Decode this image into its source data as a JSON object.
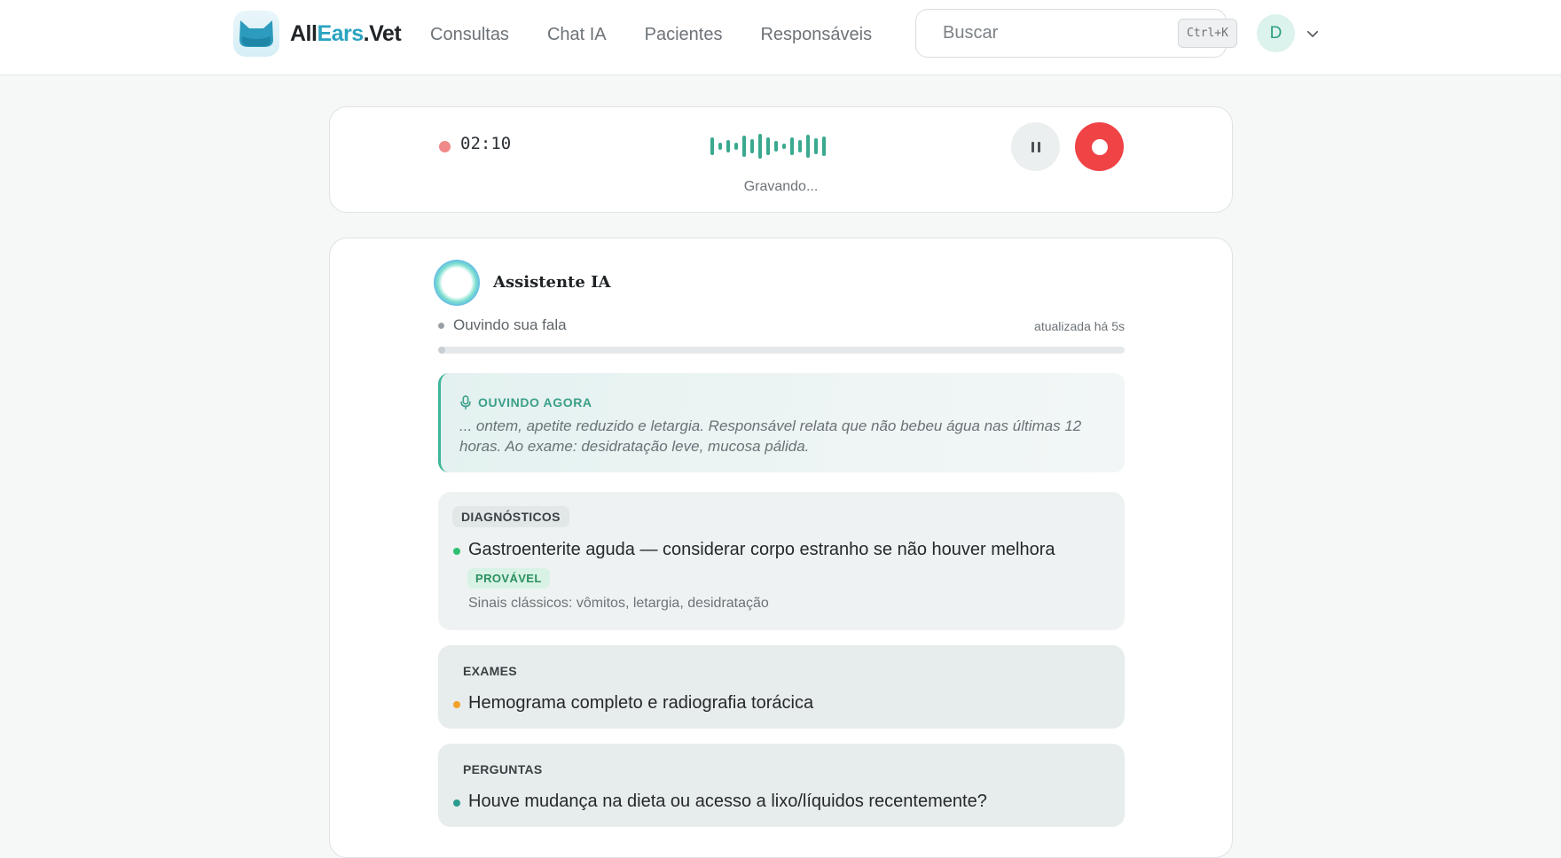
{
  "app": {
    "brand_part1": "All",
    "brand_part2": "Ears",
    "brand_part3": ".Vet",
    "brand_accent_color": "#2aa3c0"
  },
  "nav": {
    "items": [
      {
        "label": "Consultas"
      },
      {
        "label": "Chat IA"
      },
      {
        "label": "Pacientes"
      },
      {
        "label": "Responsáveis"
      }
    ]
  },
  "search": {
    "placeholder": "Buscar",
    "shortcut": "Ctrl+K",
    "icon": "search-icon"
  },
  "user": {
    "initial": "D",
    "menu_icon": "chevron-down-icon"
  },
  "recorder": {
    "time": "02:10",
    "status": "Gravando...",
    "pause_icon": "pause-icon",
    "stop_icon": "stop-icon",
    "stop_color": "#ef4346"
  },
  "assistant": {
    "title": "Assistente IA",
    "listening_status": "Ouvindo sua fala",
    "updated": "atualizada há 5s",
    "progress": 0.01,
    "live": {
      "label": "OUVINDO AGORA",
      "icon": "microphone-icon",
      "text": "... ontem, apetite reduzido e letargia. Responsável relata que não bebeu água nas últimas 12 horas. Ao exame: desidratação leve, mucosa pálida."
    },
    "sections": {
      "diagnosticos": {
        "label": "DIAGNÓSTICOS",
        "item": "Gastroenterite aguda — considerar corpo estranho se não houver melhora",
        "badge": "PROVÁVEL",
        "detail": "Sinais clássicos: vômitos, letargia, desidratação",
        "dot_color": "#2fbf71"
      },
      "exames": {
        "label": "EXAMES",
        "item": "Hemograma completo e radiografia torácica",
        "dot_color": "#f2a22a"
      },
      "perguntas": {
        "label": "PERGUNTAS",
        "item": "Houve mudança na dieta ou acesso a lixo/líquidos recentemente?",
        "dot_color": "#2a9d8f"
      }
    }
  }
}
